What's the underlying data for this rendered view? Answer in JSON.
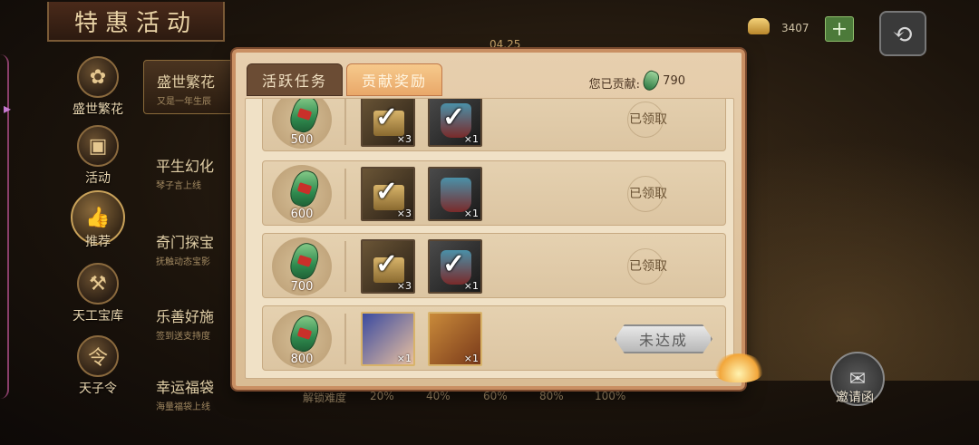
{
  "header": {
    "title": "特惠活动"
  },
  "background": {
    "date": "04.25"
  },
  "nav": {
    "items": [
      {
        "label": "盛世繁花",
        "icon": "peony-icon"
      },
      {
        "label": "活动",
        "icon": "gift-icon"
      },
      {
        "label": "推荐",
        "icon": "thumbs-up-icon"
      },
      {
        "label": "天工宝库",
        "icon": "treasure-icon"
      },
      {
        "label": "天子令",
        "icon": "token-icon"
      }
    ]
  },
  "subnav": {
    "items": [
      {
        "title": "盛世繁花",
        "desc": "又是一年生辰"
      },
      {
        "title": "平生幻化",
        "desc": "琴子言上线"
      },
      {
        "title": "奇门探宝",
        "desc": "抚触动态宝影"
      },
      {
        "title": "乐善好施",
        "desc": "签到送支持度"
      },
      {
        "title": "幸运福袋",
        "desc": "海量福袋上线"
      }
    ]
  },
  "hud": {
    "currency_value": "3407",
    "plus_label": "+",
    "back_label": "⟲"
  },
  "progress": {
    "labels": [
      "解锁难度",
      "20%",
      "40%",
      "60%",
      "80%",
      "100%"
    ]
  },
  "invite": {
    "label": "邀请函"
  },
  "modal": {
    "tabs": [
      {
        "label": "活跃任务"
      },
      {
        "label": "贡献奖励"
      }
    ],
    "contribution_label": "您已贡献:",
    "contribution_value": "790",
    "rows": [
      {
        "threshold": "500",
        "rewards": [
          {
            "qty": "×3"
          },
          {
            "qty": "×1"
          }
        ],
        "status": "已领取"
      },
      {
        "threshold": "600",
        "rewards": [
          {
            "qty": "×3"
          },
          {
            "qty": "×1"
          }
        ],
        "status": "已领取"
      },
      {
        "threshold": "700",
        "rewards": [
          {
            "qty": "×3"
          },
          {
            "qty": "×1"
          }
        ],
        "status": "已领取"
      },
      {
        "threshold": "800",
        "rewards": [
          {
            "qty": "×1"
          },
          {
            "qty": "×1"
          }
        ],
        "status": "未达成"
      }
    ]
  },
  "colors": {
    "modal_bg": "#e7cfae",
    "active_tab": "#e9a869",
    "claimed_text": "#6a5234"
  }
}
